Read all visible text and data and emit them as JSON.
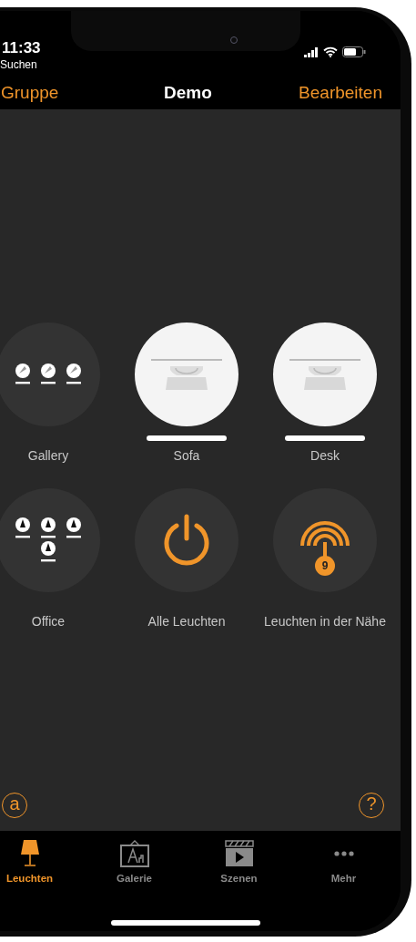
{
  "status_bar": {
    "time": "11:33",
    "back_label": "Suchen"
  },
  "nav_bar": {
    "left": "Gruppe",
    "title": "Demo",
    "right": "Bearbeiten"
  },
  "tiles": [
    {
      "kind": "trio",
      "label": "Gallery",
      "on": false
    },
    {
      "kind": "light",
      "label": "Sofa",
      "on": true
    },
    {
      "kind": "light",
      "label": "Desk",
      "on": true
    },
    {
      "kind": "quartet",
      "label": "Office",
      "on": false
    },
    {
      "kind": "all",
      "label": "Alle Leuchten"
    },
    {
      "kind": "nearby",
      "label": "Leuchten in der Nähe",
      "badge": "9"
    }
  ],
  "corner_buttons": {
    "left": "a",
    "right": "?"
  },
  "tabs": [
    {
      "kind": "lamp",
      "label": "Leuchten",
      "selected": true
    },
    {
      "kind": "gallery",
      "label": "Galerie",
      "selected": false
    },
    {
      "kind": "scenes",
      "label": "Szenen",
      "selected": false
    },
    {
      "kind": "more",
      "label": "Mehr",
      "selected": false
    }
  ]
}
